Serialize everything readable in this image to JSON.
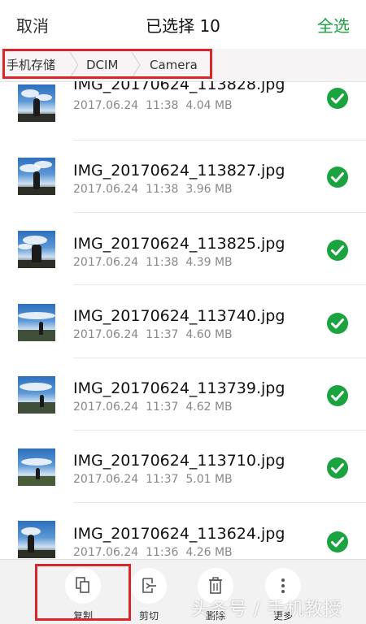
{
  "header": {
    "cancel_label": "取消",
    "title": "已选择 10",
    "select_all_label": "全选",
    "accent_color": "#1aa33f"
  },
  "breadcrumb": {
    "items": [
      "手机存储",
      "DCIM",
      "Camera"
    ],
    "highlight_color": "#d8262a"
  },
  "files": [
    {
      "name": "IMG_20170624_113828.jpg",
      "date": "2017.06.24",
      "time": "11:38",
      "size": "4.04 MB",
      "checked": true
    },
    {
      "name": "IMG_20170624_113827.jpg",
      "date": "2017.06.24",
      "time": "11:38",
      "size": "3.96 MB",
      "checked": true
    },
    {
      "name": "IMG_20170624_113825.jpg",
      "date": "2017.06.24",
      "time": "11:38",
      "size": "4.39 MB",
      "checked": true
    },
    {
      "name": "IMG_20170624_113740.jpg",
      "date": "2017.06.24",
      "time": "11:37",
      "size": "4.60 MB",
      "checked": true
    },
    {
      "name": "IMG_20170624_113739.jpg",
      "date": "2017.06.24",
      "time": "11:37",
      "size": "4.62 MB",
      "checked": true
    },
    {
      "name": "IMG_20170624_113710.jpg",
      "date": "2017.06.24",
      "time": "11:37",
      "size": "5.01 MB",
      "checked": true
    },
    {
      "name": "IMG_20170624_113624.jpg",
      "date": "2017.06.24",
      "time": "11:36",
      "size": "4.26 MB",
      "checked": true
    }
  ],
  "toolbar": {
    "copy_label": "复制",
    "cut_label": "剪切",
    "delete_label": "删除",
    "more_label": "更多",
    "icons": [
      "copy-icon",
      "cut-icon",
      "trash-icon",
      "more-vertical-icon"
    ]
  },
  "watermark": "头条号 / 手机教授"
}
